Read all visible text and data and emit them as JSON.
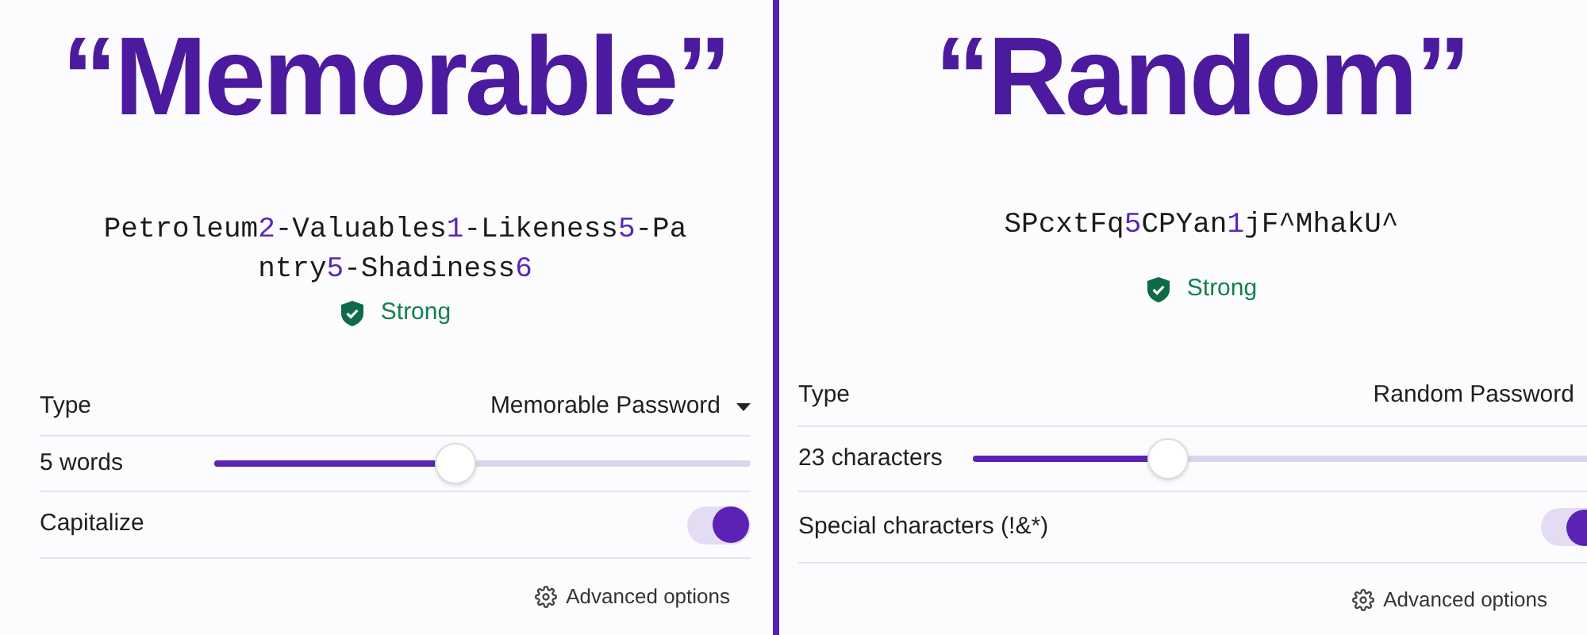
{
  "panels": [
    {
      "heading": "“Memorable”",
      "password_lines": [
        [
          {
            "text": "Petroleum",
            "kind": "letters"
          },
          {
            "text": "2",
            "kind": "digit"
          },
          {
            "text": "-Valuables",
            "kind": "letters"
          },
          {
            "text": "1",
            "kind": "digit"
          },
          {
            "text": "-Likeness",
            "kind": "letters"
          },
          {
            "text": "5",
            "kind": "digit"
          },
          {
            "text": "-Pa",
            "kind": "letters"
          }
        ],
        [
          {
            "text": "ntry",
            "kind": "letters"
          },
          {
            "text": "5",
            "kind": "digit"
          },
          {
            "text": "-Shadiness",
            "kind": "letters"
          },
          {
            "text": "6",
            "kind": "digit"
          }
        ]
      ],
      "strength": "Strong",
      "type_label": "Type",
      "type_value": "Memorable Password",
      "length_label": "5 words",
      "length": {
        "level": 0.45
      },
      "toggle_label": "Capitalize",
      "toggle_on": true,
      "advanced": "Advanced options"
    },
    {
      "heading": "“Random”",
      "password_lines": [
        [
          {
            "text": "SPcxtFq",
            "kind": "letters"
          },
          {
            "text": "5",
            "kind": "digit"
          },
          {
            "text": "CPYan",
            "kind": "letters"
          },
          {
            "text": "1",
            "kind": "digit"
          },
          {
            "text": "jF^MhakU^",
            "kind": "letters"
          }
        ]
      ],
      "strength": "Strong",
      "type_label": "Type",
      "type_value": "Random Password",
      "length_label": "23 characters",
      "length": {
        "level": 0.31
      },
      "toggle_label": "Special characters (!&*)",
      "toggle_on": true,
      "advanced": "Advanced options"
    }
  ]
}
